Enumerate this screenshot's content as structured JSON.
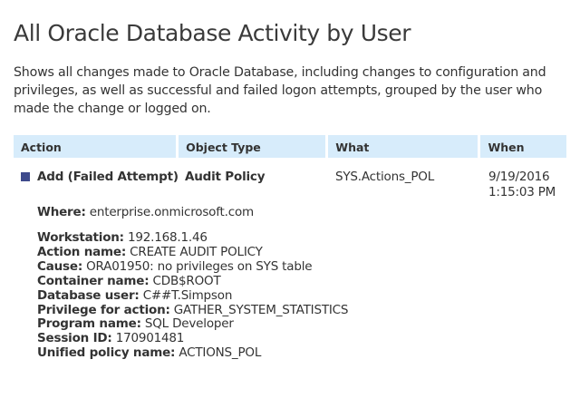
{
  "report": {
    "title": "All Oracle Database Activity by User",
    "description": "Shows all changes made to Oracle Database, including changes to configuration and privileges, as well as successful and failed logon attempts, grouped by the user who made the change or logged on."
  },
  "table": {
    "columns": {
      "action": "Action",
      "object_type": "Object Type",
      "what": "What",
      "when": "When"
    },
    "row": {
      "action": "Add (Failed Attempt)",
      "object_type": "Audit Policy",
      "what": "SYS.Actions_POL",
      "when_date": "9/19/2016",
      "when_time": "1:15:03 PM",
      "where_label": "Where:",
      "where_value": "enterprise.onmicrosoft.com",
      "details": [
        {
          "label": "Workstation:",
          "value": "192.168.1.46"
        },
        {
          "label": "Action name:",
          "value": "CREATE AUDIT POLICY"
        },
        {
          "label": "Cause:",
          "value": "ORA01950: no privileges on SYS table"
        },
        {
          "label": "Container name:",
          "value": "CDB$ROOT"
        },
        {
          "label": "Database user:",
          "value": "C##T.Simpson"
        },
        {
          "label": "Privilege for action:",
          "value": "GATHER_SYSTEM_STATISTICS"
        },
        {
          "label": "Program name:",
          "value": "SQL Developer"
        },
        {
          "label": "Session ID:",
          "value": "170901481"
        },
        {
          "label": "Unified policy name:",
          "value": "ACTIONS_POL"
        }
      ]
    }
  },
  "colors": {
    "header_bg": "#d7ecfb",
    "marker": "#3e4a8c",
    "text": "#333333"
  }
}
